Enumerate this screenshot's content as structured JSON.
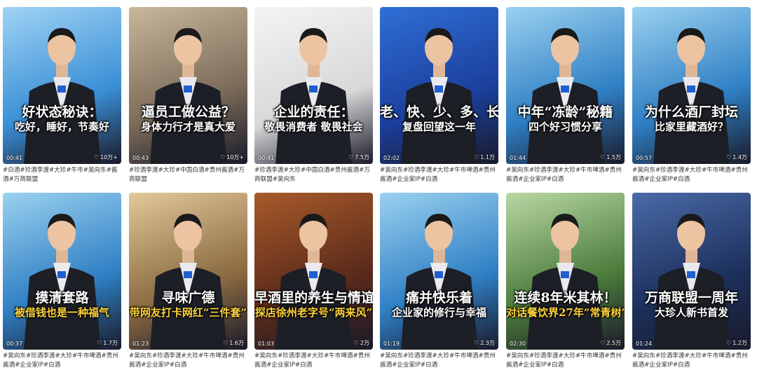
{
  "videos": [
    {
      "line1": "好状态秘诀：",
      "line2": "吃好，睡好，节奏好",
      "duration": "00:41",
      "likes": "10万+",
      "tags": "#白酒#珍酒李渡#大珍#牛市#吴向东#酱酒#万商联盟",
      "theme": "#3a8fd6",
      "theme2": "#9fd3f5"
    },
    {
      "line1": "逼员工做公益？",
      "line2": "身体力行才是真大爱",
      "duration": "00:43",
      "likes": "10万+",
      "tags": "#珍酒李渡#大珍#中国白酒#贵州酱酒#万商联盟",
      "theme": "#7a6a58",
      "theme2": "#c9b79c"
    },
    {
      "line1": "企业的责任：",
      "line2": "敬畏消费者 敬畏社会",
      "duration": "00:41",
      "likes": "7.5万",
      "tags": "#珍酒李渡#大珍#中国白酒#贵州酱酒#万商联盟#吴向东",
      "theme": "#d8d8d8",
      "theme2": "#f4f4f4"
    },
    {
      "line1": "老、快、少、多、长",
      "line2": "复盘回望这一年",
      "duration": "02:02",
      "likes": "1.1万",
      "tags": "#吴向东#珍酒李渡#大珍#牛市啤酒#贵州酱酒#企业家IP#白酒",
      "theme": "#1b3f9c",
      "theme2": "#2f6fd6"
    },
    {
      "line1": "中年“冻龄”秘籍",
      "line2": "四个好习惯分享",
      "duration": "01:44",
      "likes": "1.5万",
      "tags": "#吴向东#珍酒李渡#大珍#牛市啤酒#贵州酱酒#企业家IP#白酒",
      "theme": "#2f7fc4",
      "theme2": "#9ad1f0"
    },
    {
      "line1": "为什么酒厂封坛",
      "line2": "比家里藏酒好？",
      "duration": "00:57",
      "likes": "1.4万",
      "tags": "#吴向东#珍酒李渡#大珍#牛市啤酒#贵州酱酒#企业家IP#白酒",
      "theme": "#2f7fc4",
      "theme2": "#9ad1f0"
    },
    {
      "line1": "摸清套路",
      "line2": "被借钱也是一种福气",
      "duration": "00:37",
      "likes": "1.7万",
      "tags": "#吴向东#珍酒李渡#大珍#牛市啤酒#贵州酱酒#企业家IP#白酒",
      "theme": "#2f7fc4",
      "theme2": "#9ad1f0"
    },
    {
      "line1": "寻味广德",
      "line2": "带网友打卡网红“三件套”",
      "duration": "01:23",
      "likes": "1.6万",
      "tags": "#吴向东#珍酒李渡#大珍#牛市啤酒#贵州酱酒#企业家IP#白酒",
      "theme": "#8a6a40",
      "theme2": "#e2c89a"
    },
    {
      "line1": "早酒里的养生与情谊",
      "line2": "探店徐州老字号“两来风”",
      "duration": "01:03",
      "likes": "2万",
      "tags": "#吴向东#珍酒李渡#大珍#牛市啤酒#贵州酱酒#企业家IP#白酒",
      "theme": "#5a2a1a",
      "theme2": "#a85a2a"
    },
    {
      "line1": "痛并快乐着",
      "line2": "企业家的修行与幸福",
      "duration": "01:19",
      "likes": "2.3万",
      "tags": "#吴向东#珍酒李渡#大珍#牛市啤酒#贵州酱酒#企业家IP#白酒",
      "theme": "#2f7fc4",
      "theme2": "#9ad1f0"
    },
    {
      "line1": "连续8年米其林！",
      "line2": "对话餐饮界27年“常青树”",
      "duration": "02:30",
      "likes": "2.5万",
      "tags": "#吴向东#珍酒李渡#大珍#牛市啤酒#贵州酱酒#企业家IP#白酒",
      "theme": "#4a7a3a",
      "theme2": "#b9d8a4"
    },
    {
      "line1": "万商联盟一周年",
      "line2": "大珍人新书首发",
      "duration": "01:24",
      "likes": "1.2万",
      "tags": "#吴向东#珍酒李渡#大珍#牛市啤酒#贵州酱酒#企业家IP#白酒",
      "theme": "#1c2f5a",
      "theme2": "#4a6aa8"
    }
  ]
}
